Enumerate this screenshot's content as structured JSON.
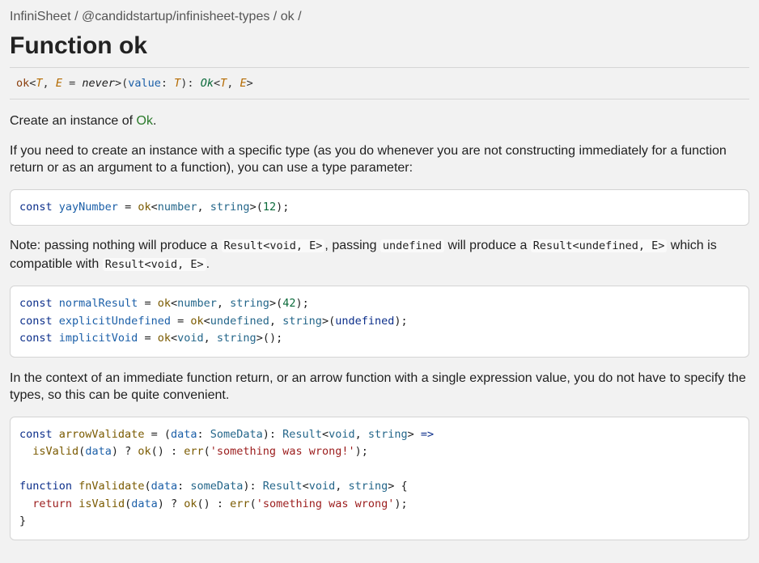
{
  "breadcrumb": {
    "items": [
      "InfiniSheet",
      "@candidstartup/infinisheet-types",
      "ok"
    ],
    "separator": "/"
  },
  "title": "Function ok",
  "signature": {
    "name": "ok",
    "type_param_1": "T",
    "type_param_2": "E",
    "default_type": "never",
    "param_name": "value",
    "param_type": "T",
    "return_type": "Ok",
    "ret_arg_1": "T",
    "ret_arg_2": "E"
  },
  "paragraphs": {
    "intro_prefix": "Create an instance of ",
    "intro_link": "Ok",
    "intro_suffix": ".",
    "type_param_text": "If you need to create an instance with a specific type (as you do whenever you are not constructing immediately for a function return or as an argument to a function), you can use a type parameter:",
    "note_1": "Note: passing nothing will produce a ",
    "note_code_1": "Result<void, E>",
    "note_2": ", passing ",
    "note_code_2": "undefined",
    "note_3": " will produce a ",
    "note_code_3": "Result<undefined, E>",
    "note_4": " which is compatible with ",
    "note_code_4": "Result<void, E>",
    "note_5": ".",
    "context_text": "In the context of an immediate function return, or an arrow function with a single expression value, you do not have to specify the types, so this can be quite convenient."
  },
  "code": {
    "kw_const": "const",
    "kw_function": "function",
    "kw_return": "return",
    "fn_ok": "ok",
    "fn_err": "err",
    "fn_isValid": "isValid",
    "t_number": "number",
    "t_string": "string",
    "t_undefined": "undefined",
    "t_void": "void",
    "v_yayNumber": "yayNumber",
    "v_normalResult": "normalResult",
    "v_explicitUndefined": "explicitUndefined",
    "v_implicitVoid": "implicitVoid",
    "v_arrowValidate": "arrowValidate",
    "fn_fnValidate": "fnValidate",
    "v_data": "data",
    "t_SomeData": "SomeData",
    "t_someData": "someData",
    "t_Result": "Result",
    "n_12": "12",
    "n_42": "42",
    "s_wrong_bang": "'something was wrong!'",
    "s_wrong": "'something was wrong'"
  }
}
